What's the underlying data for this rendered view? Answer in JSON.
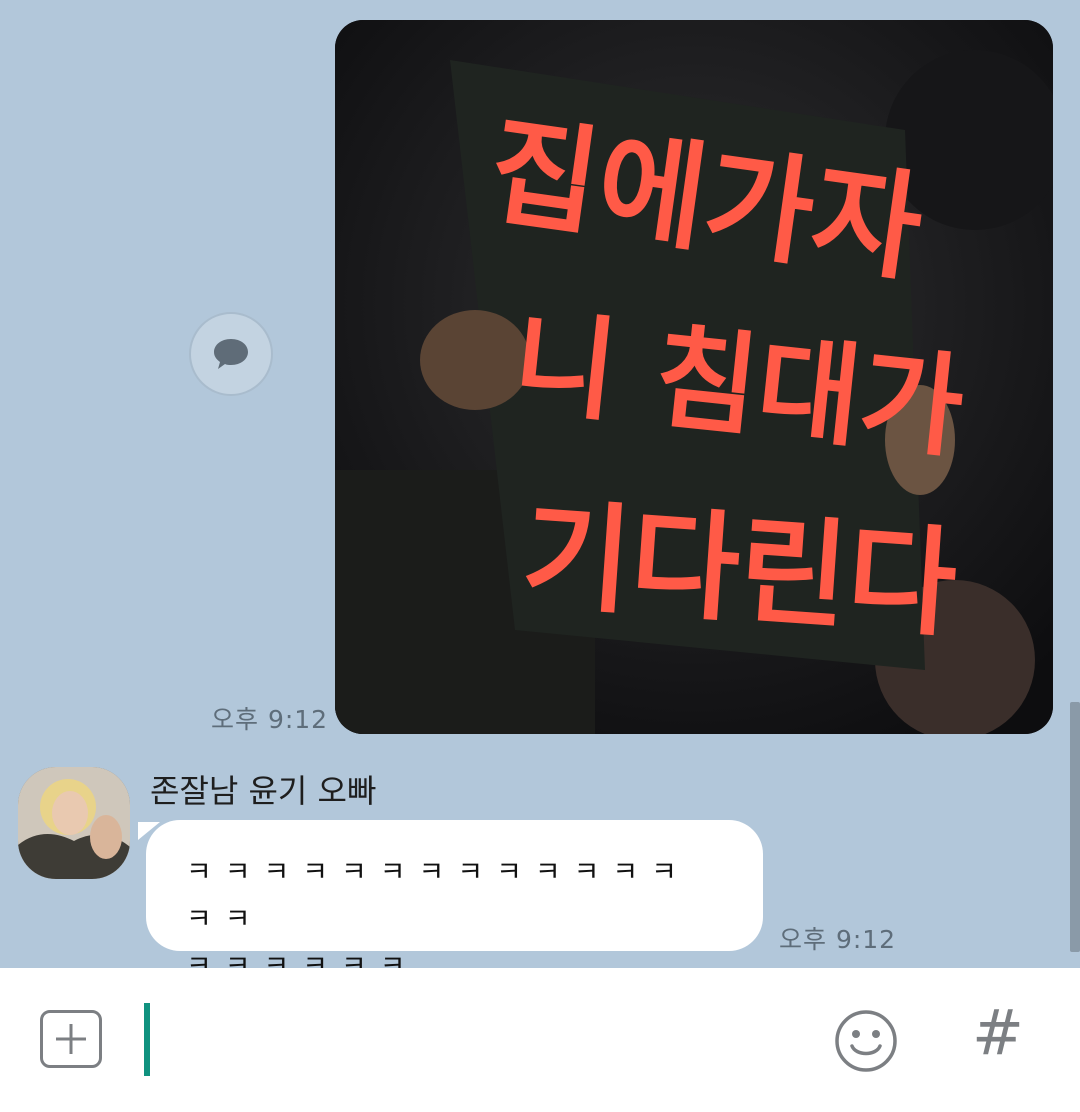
{
  "messages": {
    "outgoing_image": {
      "sign_lines": [
        "집에가자",
        "니 침대가",
        "기다린다"
      ],
      "time": "오후 9:12"
    },
    "incoming_text": {
      "sender": "존잘남 윤기 오빠",
      "text": "ㅋㅋㅋㅋㅋㅋㅋㅋㅋㅋㅋㅋㅋㅋㅋ\nㅋㅋㅋㅋㅋㅋ",
      "time": "오후 9:12"
    }
  },
  "icons": {
    "share": "speech-bubble-icon",
    "attach": "plus-icon",
    "emoji": "smiley-icon",
    "hashtag": "hash-icon"
  },
  "input_bar": {
    "hash_label": "#"
  },
  "colors": {
    "chat_background": "#b2c7da",
    "bubble": "#ffffff",
    "caret": "#10927f",
    "sign_text": "#ff5a47"
  }
}
